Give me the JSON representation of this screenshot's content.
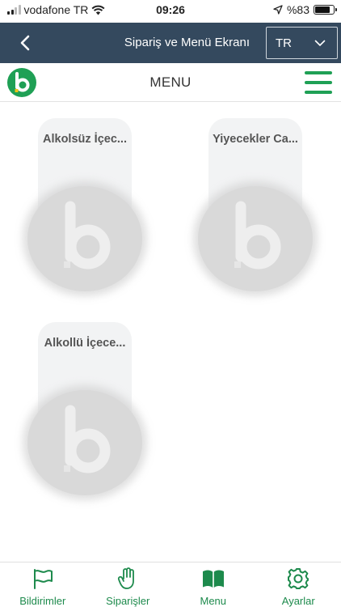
{
  "status_bar": {
    "carrier": "vodafone TR",
    "time": "09:26",
    "battery": "%83",
    "battery_level": 0.83
  },
  "nav": {
    "title": "Sipariş ve Menü Ekranı",
    "language": "TR"
  },
  "header": {
    "title": "MENU"
  },
  "categories": [
    {
      "label": "Alkolsüz İçec..."
    },
    {
      "label": "Yiyecekler Ca..."
    },
    {
      "label": "Alkollü İçece..."
    }
  ],
  "tabs": [
    {
      "label": "Bildirimler",
      "icon": "flag-icon"
    },
    {
      "label": "Siparişler",
      "icon": "hand-icon"
    },
    {
      "label": "Menu",
      "icon": "book-icon"
    },
    {
      "label": "Ayarlar",
      "icon": "gear-icon"
    }
  ],
  "colors": {
    "nav_bg": "#34495e",
    "brand_green": "#1fa055",
    "tab_green": "#1d8a4c"
  }
}
